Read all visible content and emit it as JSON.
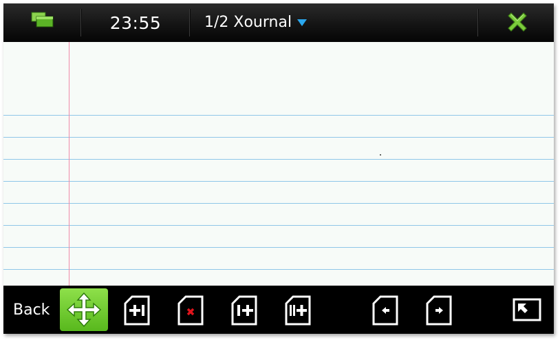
{
  "statusbar": {
    "switcher_icon": "task-switcher-icon",
    "time": "23:55",
    "title": "1/2 Xournal",
    "menu_icon": "dropdown-triangle-icon",
    "close_icon": "close-x-icon"
  },
  "toolbar": {
    "back_label": "Back",
    "tools": [
      {
        "icon": "move-arrows-icon",
        "active": true
      },
      {
        "icon": "add-page-icon"
      },
      {
        "icon": "delete-page-icon"
      },
      {
        "icon": "insert-page-after-icon"
      },
      {
        "icon": "insert-page-end-icon"
      },
      {
        "icon": "previous-page-icon"
      },
      {
        "icon": "next-page-icon"
      },
      {
        "icon": "fullscreen-icon"
      }
    ]
  },
  "colors": {
    "accent_green": "#6cc82d",
    "menu_caret": "#2aa7ee",
    "paper": "#f7fbf8",
    "ruling": "#8ec6e8",
    "margin_line": "#f08aa8",
    "delete_red": "#e0141c"
  }
}
